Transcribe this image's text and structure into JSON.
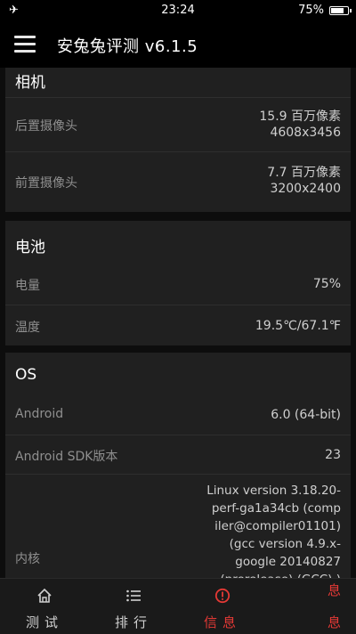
{
  "status_bar": {
    "airplane_icon": "airplane-icon",
    "time": "23:24",
    "battery_text": "75%",
    "battery_level": 0.75
  },
  "app_bar": {
    "title": "安兔兔评测 v6.1.5",
    "menu_icon": "hamburger-menu-icon"
  },
  "camera": {
    "header": "相机",
    "rear_label": "后置摄像头",
    "rear_value_1": "15.9 百万像素",
    "rear_value_2": "4608x3456",
    "front_label": "前置摄像头",
    "front_value_1": "7.7 百万像素",
    "front_value_2": "3200x2400"
  },
  "battery": {
    "header": "电池",
    "level_label": "电量",
    "level_value": "75%",
    "temp_label": "温度",
    "temp_value": "19.5℃/67.1℉"
  },
  "os": {
    "header": "OS",
    "android_label": "Android",
    "android_value": "6.0 (64-bit)",
    "sdk_label": "Android SDK版本",
    "sdk_value": "23",
    "kernel_label": "内核",
    "kernel_lines": [
      "Linux version 3.18.20-",
      "perf-ga1a34cb (comp",
      "iler@compiler01101)",
      "(gcc version 4.9.x-",
      "google 20140827",
      "(prerelease) (GCC) )"
    ]
  },
  "bottom_nav": {
    "test": "测试",
    "rank": "排行",
    "info": "信息",
    "more_top": "息",
    "more_bottom": "息",
    "accent": "#e53935"
  }
}
